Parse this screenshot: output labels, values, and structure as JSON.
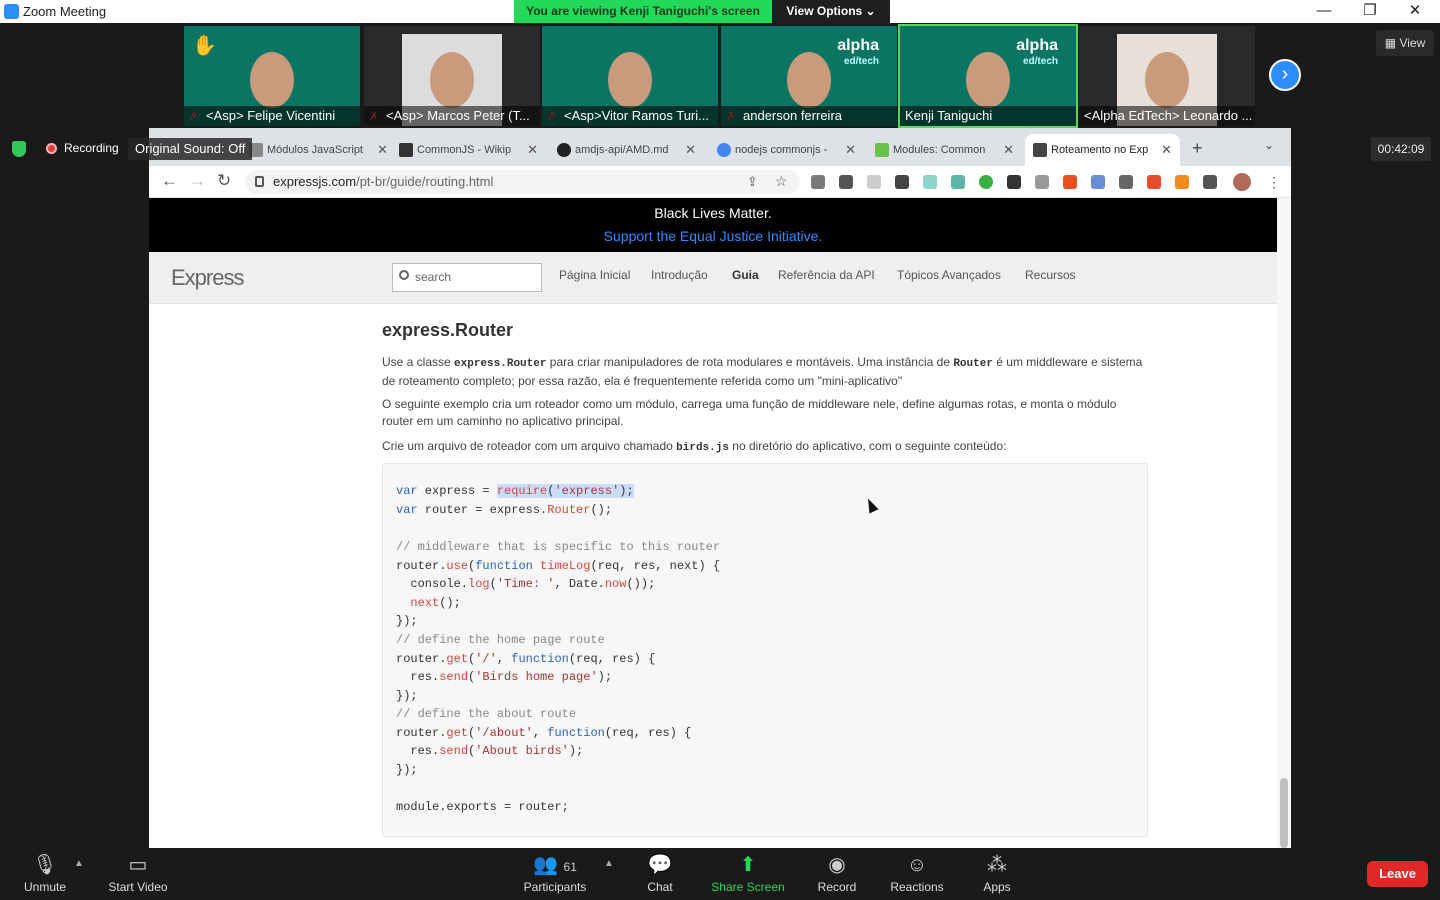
{
  "zoom": {
    "window_title": "Zoom Meeting",
    "banner": "You are viewing Kenji Taniguchi's screen",
    "view_options": "View Options ⌄",
    "view_label": "View",
    "recording_label": "Recording",
    "original_sound": "Original Sound: Off",
    "timer": "00:42:09",
    "participants": [
      {
        "name": "<Asp> Felipe Vicentini",
        "muted": true
      },
      {
        "name": "<Asp> Marcos Peter (T...",
        "muted": true
      },
      {
        "name": "<Asp>Vitor Ramos Turi...",
        "muted": true
      },
      {
        "name": "anderson ferreira",
        "muted": true
      },
      {
        "name": "Kenji Taniguchi",
        "muted": false
      },
      {
        "name": "<Alpha EdTech> Leonardo ...",
        "muted": false
      }
    ],
    "tile_logo": {
      "main": "alpha",
      "sub": "ed/tech"
    },
    "controls": {
      "unmute": "Unmute",
      "start_video": "Start Video",
      "participants": "Participants",
      "participant_count": "61",
      "chat": "Chat",
      "share_screen": "Share Screen",
      "record": "Record",
      "reactions": "Reactions",
      "apps": "Apps",
      "leave": "Leave"
    }
  },
  "browser": {
    "tabs": [
      {
        "title": "Módulos JavaScript",
        "color": "#888888"
      },
      {
        "title": "CommonJS - Wikip",
        "color": "#333333"
      },
      {
        "title": "amdjs-api/AMD.md",
        "color": "#222222"
      },
      {
        "title": "nodejs commonjs -",
        "color": "#4285f4"
      },
      {
        "title": "Modules: Common",
        "color": "#6cc24a"
      },
      {
        "title": "Roteamento no Exp",
        "color": "#444444"
      }
    ],
    "url_domain": "expressjs.com",
    "url_path": "/pt-br/guide/routing.html"
  },
  "page": {
    "blm_line1": "Black Lives Matter.",
    "blm_line2": "Support the Equal Justice Initiative.",
    "logo": "Express",
    "search_placeholder": "search",
    "nav": [
      "Página Inicial",
      "Introdução",
      "Guia",
      "Referência da API",
      "Tópicos Avançados",
      "Recursos"
    ],
    "heading": "express.Router",
    "p1a": "Use a classe ",
    "p1code": "express.Router",
    "p1b": " para criar manipuladores de rota modulares e montáveis. Uma instância de ",
    "p1code2": "Router",
    "p1c": " é um middleware e sistema de roteamento completo; por essa razão, ela é frequentemente referida como um \"mini-aplicativo\"",
    "p2": "O seguinte exemplo cria um roteador como um módulo, carrega uma função de middleware nele, define algumas rotas, e monta o módulo router em um caminho no aplicativo principal.",
    "p3a": "Crie um arquivo de roteador com um arquivo chamado ",
    "p3code": "birds.js",
    "p3b": " no diretório do aplicativo, com o seguinte conteúdo:"
  }
}
